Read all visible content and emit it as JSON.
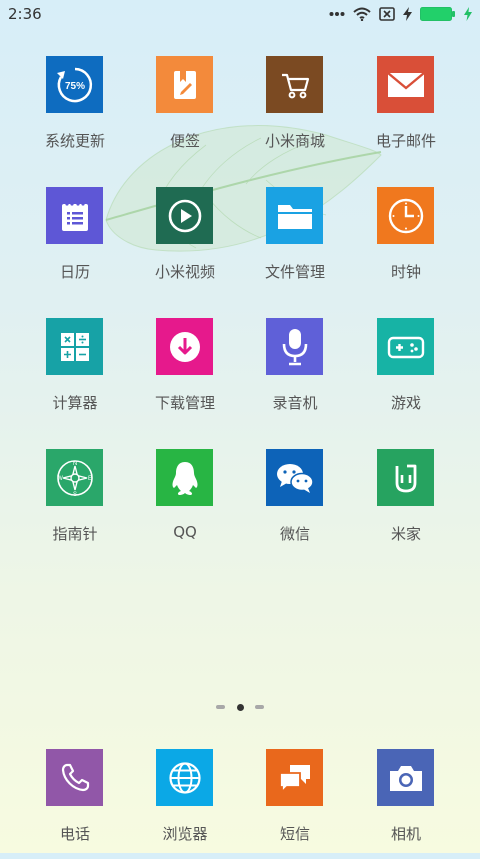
{
  "status_bar": {
    "time": "2:36"
  },
  "apps": [
    {
      "label": "系统更新",
      "icon": "system-update-icon",
      "color": "#0e6cc0",
      "badge_text": "75%"
    },
    {
      "label": "便签",
      "icon": "notes-icon",
      "color": "#f38a3b"
    },
    {
      "label": "小米商城",
      "icon": "shopping-cart-icon",
      "color": "#7b4a22"
    },
    {
      "label": "电子邮件",
      "icon": "mail-icon",
      "color": "#d94f38"
    },
    {
      "label": "日历",
      "icon": "calendar-icon",
      "color": "#5e57d6"
    },
    {
      "label": "小米视频",
      "icon": "video-play-icon",
      "color": "#1f6b52"
    },
    {
      "label": "文件管理",
      "icon": "folder-icon",
      "color": "#1aa2e3"
    },
    {
      "label": "时钟",
      "icon": "clock-icon",
      "color": "#f0781e"
    },
    {
      "label": "计算器",
      "icon": "calculator-icon",
      "color": "#17a2a6"
    },
    {
      "label": "下载管理",
      "icon": "download-icon",
      "color": "#e6198c"
    },
    {
      "label": "录音机",
      "icon": "microphone-icon",
      "color": "#5f60d8"
    },
    {
      "label": "游戏",
      "icon": "gamepad-icon",
      "color": "#17b3a5"
    },
    {
      "label": "指南针",
      "icon": "compass-icon",
      "color": "#2aa76a"
    },
    {
      "label": "QQ",
      "icon": "qq-penguin-icon",
      "color": "#28b544"
    },
    {
      "label": "微信",
      "icon": "wechat-icon",
      "color": "#0d63b8"
    },
    {
      "label": "米家",
      "icon": "mijia-icon",
      "color": "#26a360"
    }
  ],
  "dock": [
    {
      "label": "电话",
      "icon": "phone-icon",
      "color": "#9157a8"
    },
    {
      "label": "浏览器",
      "icon": "globe-icon",
      "color": "#0ba8e6"
    },
    {
      "label": "短信",
      "icon": "messages-icon",
      "color": "#e9681c"
    },
    {
      "label": "相机",
      "icon": "camera-icon",
      "color": "#4a65b6"
    }
  ],
  "page_indicator": {
    "current_page": 2,
    "total_pages": 3
  }
}
